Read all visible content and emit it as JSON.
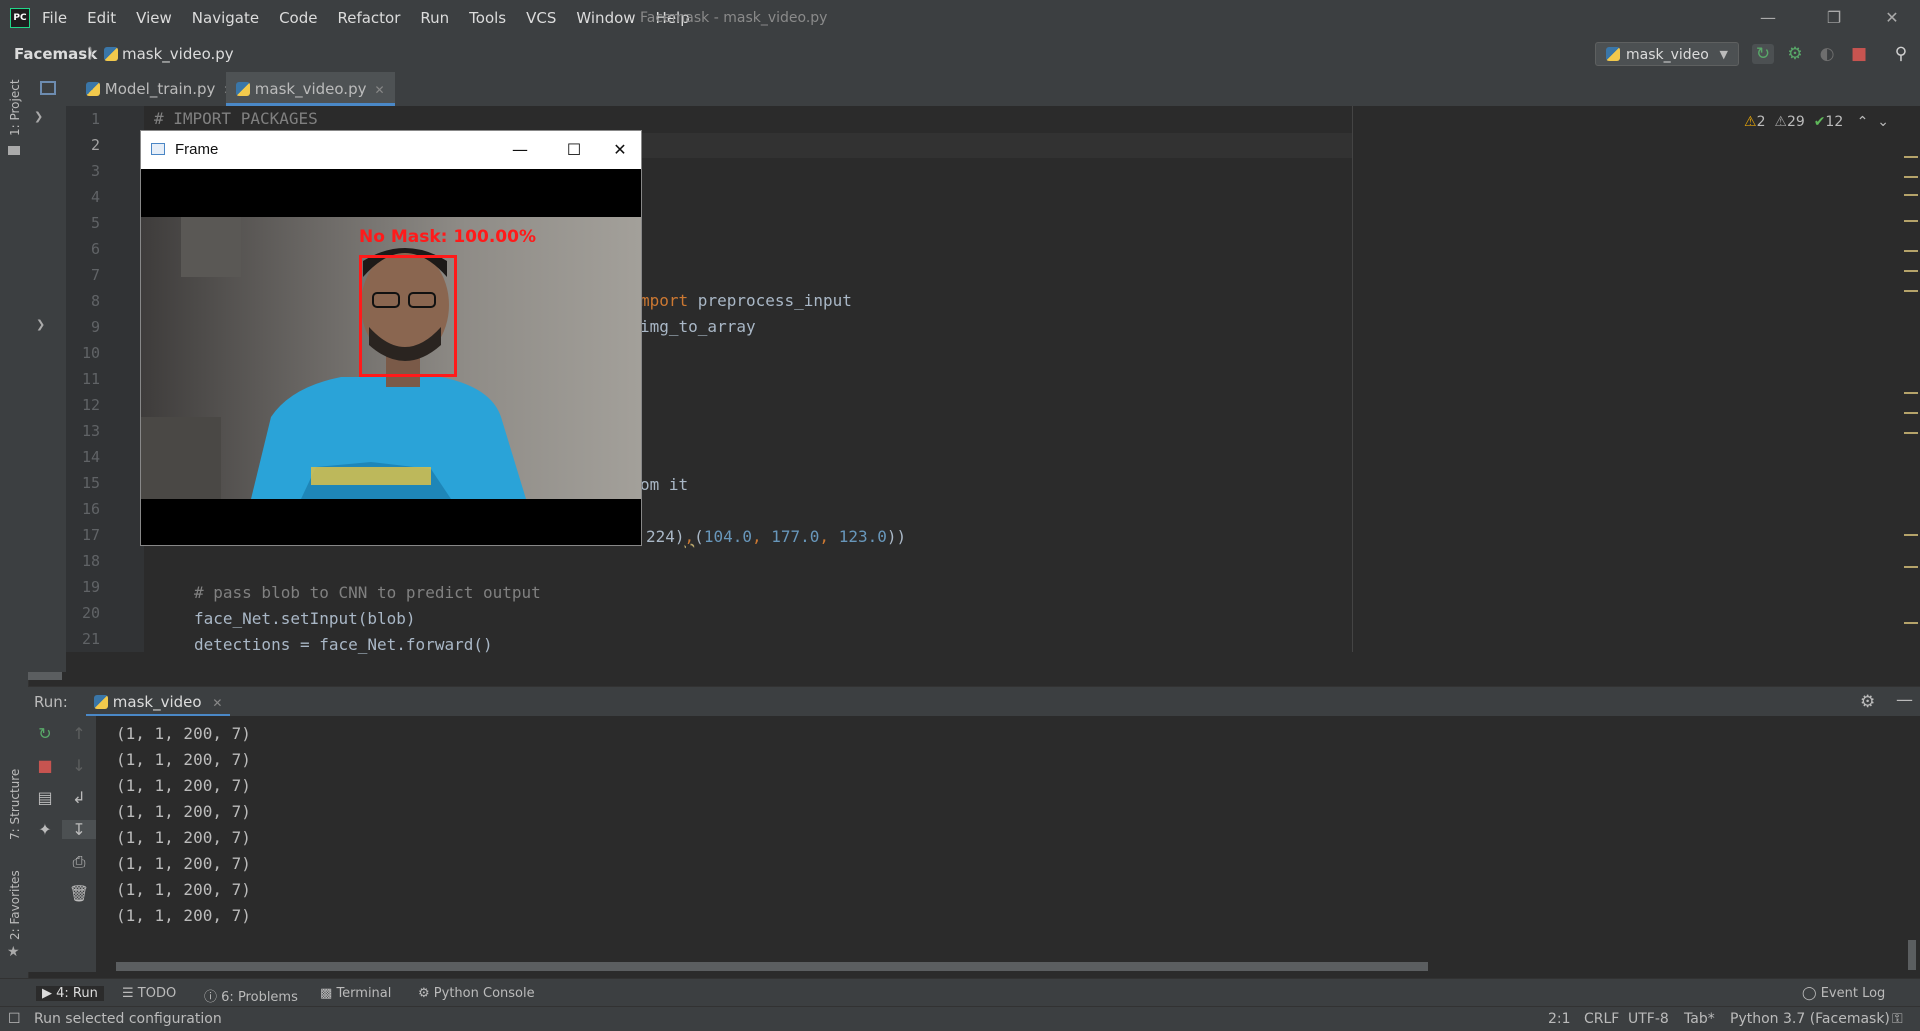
{
  "titlebar": {
    "menu": [
      "File",
      "Edit",
      "View",
      "Navigate",
      "Code",
      "Refactor",
      "Run",
      "Tools",
      "VCS",
      "Window",
      "Help"
    ],
    "window_title": "Facemask - mask_video.py"
  },
  "navbar": {
    "project": "Facemask",
    "file": "mask_video.py",
    "run_config": "mask_video"
  },
  "left_stripe": {
    "project": "1: Project",
    "structure": "7: Structure",
    "favorites": "2: Favorites"
  },
  "editor_tabs": [
    {
      "label": "Model_train.py",
      "active": false
    },
    {
      "label": "mask_video.py",
      "active": true
    }
  ],
  "inspections": {
    "warnings": "2",
    "weak_warnings": "29",
    "typos": "12"
  },
  "line_numbers": [
    "1",
    "2",
    "3",
    "4",
    "5",
    "6",
    "7",
    "8",
    "9",
    "10",
    "11",
    "12",
    "13",
    "14",
    "15",
    "16",
    "17",
    "18",
    "19",
    "20",
    "21"
  ],
  "code": {
    "l1": "# IMPORT PACKAGES",
    "l8_kw": "mport",
    "l8_rest": " preprocess_input",
    "l9": "img_to_array",
    "l15": "om it",
    "l17_a": "224)",
    "l17_b": ",",
    "l17_c": "(",
    "l17_n1": "104.0",
    "l17_n2": "177.0",
    "l17_n3": "123.0",
    "l17_d": "))",
    "l19": "# pass blob to CNN to predict output",
    "l20": "face_Net.setInput(blob)",
    "l21": "detections = face_Net.forward()"
  },
  "frame_window": {
    "title": "Frame",
    "label": "No Mask: 100.00%"
  },
  "run_panel": {
    "title": "Run:",
    "tab": "mask_video",
    "output": [
      "(1, 1, 200, 7)",
      "(1, 1, 200, 7)",
      "(1, 1, 200, 7)",
      "(1, 1, 200, 7)",
      "(1, 1, 200, 7)",
      "(1, 1, 200, 7)",
      "(1, 1, 200, 7)",
      "(1, 1, 200, 7)"
    ]
  },
  "bottom_tools": {
    "run": "4: Run",
    "todo": "TODO",
    "problems": "6: Problems",
    "terminal": "Terminal",
    "python_console": "Python Console",
    "event_log": "Event Log"
  },
  "statusbar": {
    "message": "Run selected configuration",
    "position": "2:1",
    "line_sep": "CRLF",
    "encoding": "UTF-8",
    "indent": "Tab*",
    "interpreter": "Python 3.7 (Facemask)"
  }
}
